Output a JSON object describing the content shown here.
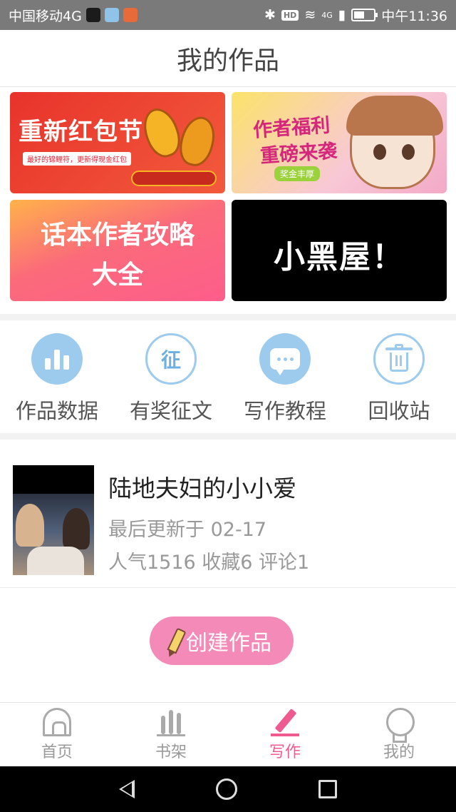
{
  "status_bar": {
    "carrier": "中国移动4G",
    "hd_label": "HD",
    "network": "4G",
    "time": "中午11:36",
    "battery_level": 0.45
  },
  "header": {
    "title": "我的作品"
  },
  "banners": [
    {
      "title": "重新红包节",
      "subtitle": "最好的锦鲤符，更新得现金红包"
    },
    {
      "line1": "作者福利",
      "line2": "重磅来袭",
      "badge": "奖金丰厚"
    },
    {
      "line1": "话本作者攻略",
      "line2": "大全"
    },
    {
      "title": "小黑屋！"
    }
  ],
  "quick_actions": [
    {
      "label": "作品数据",
      "icon": "bar-chart-icon"
    },
    {
      "label": "有奖征文",
      "icon": "zheng-icon",
      "glyph": "征"
    },
    {
      "label": "写作教程",
      "icon": "chat-bubble-icon"
    },
    {
      "label": "回收站",
      "icon": "trash-icon"
    }
  ],
  "work": {
    "title": "陆地夫妇的小小爱",
    "updated": "最后更新于 02-17",
    "stats": "人气1516 收藏6 评论1"
  },
  "create_button": {
    "label": "创建作品"
  },
  "tabs": [
    {
      "label": "首页",
      "icon": "home-icon",
      "active": false
    },
    {
      "label": "书架",
      "icon": "bookshelf-icon",
      "active": false
    },
    {
      "label": "写作",
      "icon": "pencil-icon",
      "active": true
    },
    {
      "label": "我的",
      "icon": "profile-icon",
      "active": false
    }
  ],
  "colors": {
    "accent_pink": "#ef5a8f",
    "icon_blue": "#9ccbed",
    "create_button": "#f48ab8"
  }
}
